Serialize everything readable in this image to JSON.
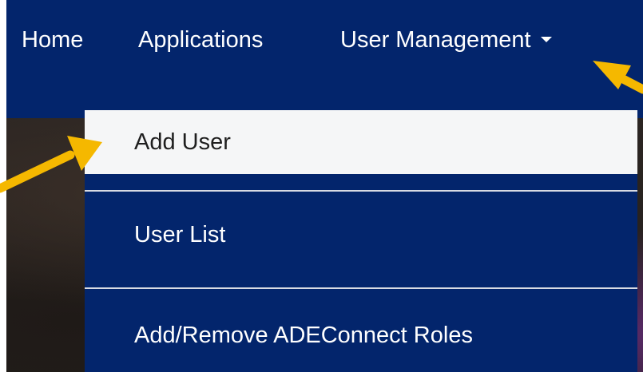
{
  "navbar": {
    "items": [
      {
        "label": "Home"
      },
      {
        "label": "Applications"
      },
      {
        "label": "User Management"
      }
    ],
    "dropdown_icon": "caret-down-icon"
  },
  "dropdown": {
    "items": [
      {
        "label": "Add User",
        "highlighted": true
      },
      {
        "label": "User List"
      },
      {
        "label": "Add/Remove ADEConnect Roles"
      }
    ]
  },
  "annotations": {
    "arrow_color": "#f5b800",
    "arrows": [
      "arrow-to-user-management",
      "arrow-to-add-user"
    ]
  },
  "colors": {
    "nav_background": "#03256c",
    "highlight_background": "#f5f6f7",
    "text_light": "#ffffff",
    "text_dark": "#1f1f1f"
  }
}
